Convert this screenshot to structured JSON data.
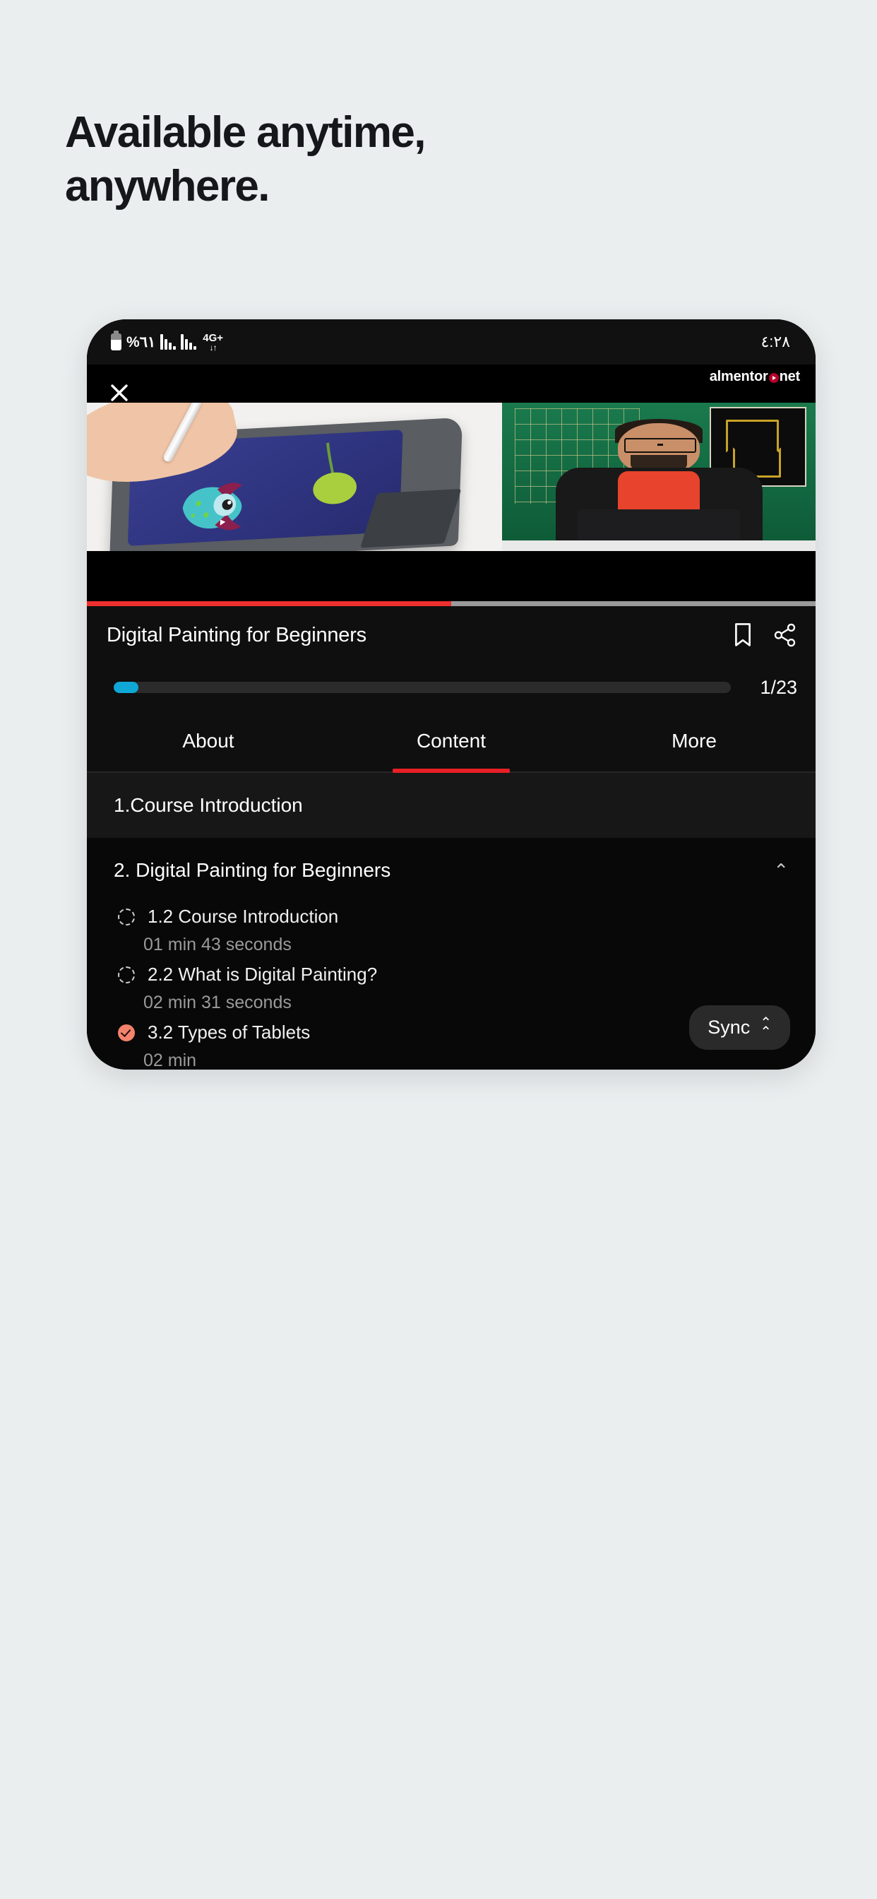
{
  "promo": {
    "headline_line1": "Available anytime,",
    "headline_line2": "anywhere.",
    "background_color": "#eaeeef",
    "text_color": "#15171a"
  },
  "phone": {
    "status_bar": {
      "battery_percent": "%٦١",
      "network_type": "4G+",
      "network_arrows": "↓↑",
      "time": "٤:٢٨"
    },
    "brand": {
      "name_left": "almentor",
      "name_right": "net",
      "dot_color": "#b3002a"
    },
    "player": {
      "close_icon": "close-icon",
      "scrub_progress_percent": 50,
      "scrub_color": "#ed2f2f"
    },
    "course": {
      "title": "Digital Painting for Beginners",
      "bookmark_icon": "bookmark-icon",
      "share_icon": "share-icon",
      "progress_percent": 4,
      "progress_color": "#0fa8d6",
      "progress_count": "1/23"
    },
    "tabs": [
      {
        "label": "About",
        "active": false
      },
      {
        "label": "Content",
        "active": true
      },
      {
        "label": "More",
        "active": false
      }
    ],
    "tab_indicator_color": "#e81f26",
    "sections": [
      {
        "title": "1.Course Introduction",
        "expanded": false,
        "shaded": true,
        "chevron": ""
      },
      {
        "title": "2. Digital Painting for Beginners",
        "expanded": true,
        "shaded": false,
        "chevron": "⌃"
      }
    ],
    "lessons": [
      {
        "title": "1.2 Course Introduction",
        "duration": "01 min 43 seconds",
        "state": "pending"
      },
      {
        "title": "2.2 What is Digital Painting?",
        "duration": "02 min 31 seconds",
        "state": "pending"
      },
      {
        "title": "3.2 Types of Tablets",
        "duration": "02 min",
        "state": "done"
      }
    ],
    "sync_button": {
      "label": "Sync",
      "chevron_up": "⌃"
    }
  }
}
